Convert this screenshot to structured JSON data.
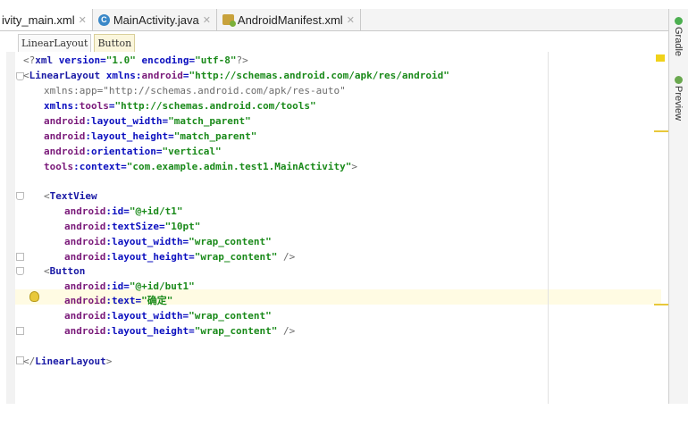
{
  "tabs": [
    {
      "label": "ivity_main.xml",
      "active": true
    },
    {
      "label": "MainActivity.java",
      "icon": "class-c-icon"
    },
    {
      "label": "AndroidManifest.xml",
      "icon": "manifest-icon"
    }
  ],
  "breadcrumb": [
    "LinearLayout",
    "Button"
  ],
  "right_panels": [
    "Gradle",
    "Preview"
  ],
  "colors": {
    "tag": "#1a1aa6",
    "value": "#1a8a1a",
    "highlight": "#fffbe3"
  },
  "code": {
    "l1": {
      "a": "<?",
      "b": "xml ",
      "c": "version=",
      "d": "\"1.0\" ",
      "e": "encoding=",
      "f": "\"utf-8\"",
      "g": "?>"
    },
    "l2": {
      "a": "<",
      "b": "LinearLayout ",
      "c": "xmlns:",
      "d": "android",
      "e": "=",
      "f": "\"http://schemas.android.com/apk/res/android\""
    },
    "l3": {
      "a": "xmlns:app=\"http://schemas.android.com/apk/res-auto\""
    },
    "l4": {
      "a": "xmlns:",
      "b": "tools",
      "c": "=",
      "d": "\"http://schemas.android.com/tools\""
    },
    "l5": {
      "a": "android",
      "b": ":layout_width=",
      "c": "\"match_parent\""
    },
    "l6": {
      "a": "android",
      "b": ":layout_height=",
      "c": "\"match_parent\""
    },
    "l7": {
      "a": "android",
      "b": ":orientation=",
      "c": "\"vertical\""
    },
    "l8": {
      "a": "tools",
      "b": ":context=",
      "c": "\"com.example.admin.test1.MainActivity\"",
      "d": ">"
    },
    "l9": {
      "a": "<",
      "b": "TextView"
    },
    "l10": {
      "a": "android",
      "b": ":id=",
      "c": "\"@+id/t1\""
    },
    "l11": {
      "a": "android",
      "b": ":textSize=",
      "c": "\"10pt\""
    },
    "l12": {
      "a": "android",
      "b": ":layout_width=",
      "c": "\"wrap_content\""
    },
    "l13": {
      "a": "android",
      "b": ":layout_height=",
      "c": "\"wrap_content\" ",
      "d": "/>"
    },
    "l14": {
      "a": "<",
      "b": "Button"
    },
    "l15": {
      "a": "android",
      "b": ":id=",
      "c": "\"@+id/but1\""
    },
    "l16": {
      "a": "android",
      "b": ":text=",
      "c": "\"确定\""
    },
    "l17": {
      "a": "android",
      "b": ":layout_width=",
      "c": "\"wrap_content\""
    },
    "l18": {
      "a": "android",
      "b": ":layout_height=",
      "c": "\"wrap_content\" ",
      "d": "/>"
    },
    "l19": {
      "a": "</",
      "b": "LinearLayout",
      "c": ">"
    }
  }
}
